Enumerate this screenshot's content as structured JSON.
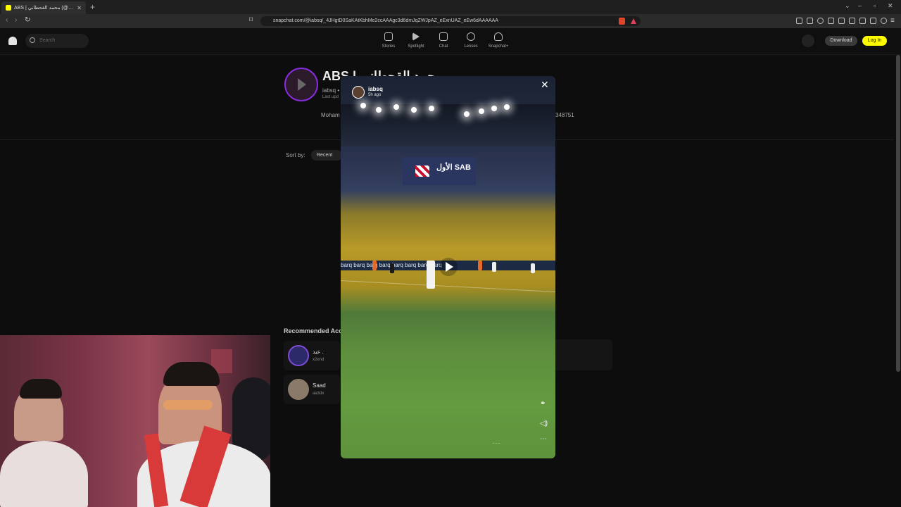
{
  "browser": {
    "tab_title": "ABS | محمد القحطاني (@iabsq)",
    "tab_close": "✕",
    "new_tab": "+",
    "url": "snapchat.com/@iabsq/_4JHgtD0SaKAtKbhMe2ccAAAgc3d6dmJqZWJpAZ_eExnUAZ_eEw6dAAAAAA"
  },
  "header": {
    "search_placeholder": "Search",
    "nav": [
      {
        "label": "Stories"
      },
      {
        "label": "Spotlight"
      },
      {
        "label": "Chat"
      },
      {
        "label": "Lenses"
      },
      {
        "label": "Snapchat+"
      }
    ],
    "download_label": "Download",
    "login_label": "Log In",
    "accent": "#fffc00"
  },
  "profile": {
    "display_name": "ABS | محمد القحطاني",
    "username": "iabsq •",
    "last_updated": "Last upd",
    "bio_start": "Moham",
    "bio_end": "348751"
  },
  "sort": {
    "label": "Sort by:",
    "selected": "Recent"
  },
  "recommended": {
    "title": "Recommended Acc",
    "accounts": [
      {
        "name": "عيد .",
        "username": "x2end"
      },
      {
        "name": "Saad",
        "username": "aa3dx"
      }
    ]
  },
  "story": {
    "username": "iabsq",
    "time_ago": "5h ago",
    "close_icon": "✕",
    "sign_text": "الأول SAB",
    "ad_board": "barq  barq  barq  barq  barq  barq  barq  barq",
    "watermark": "ـ ـ ـ"
  }
}
